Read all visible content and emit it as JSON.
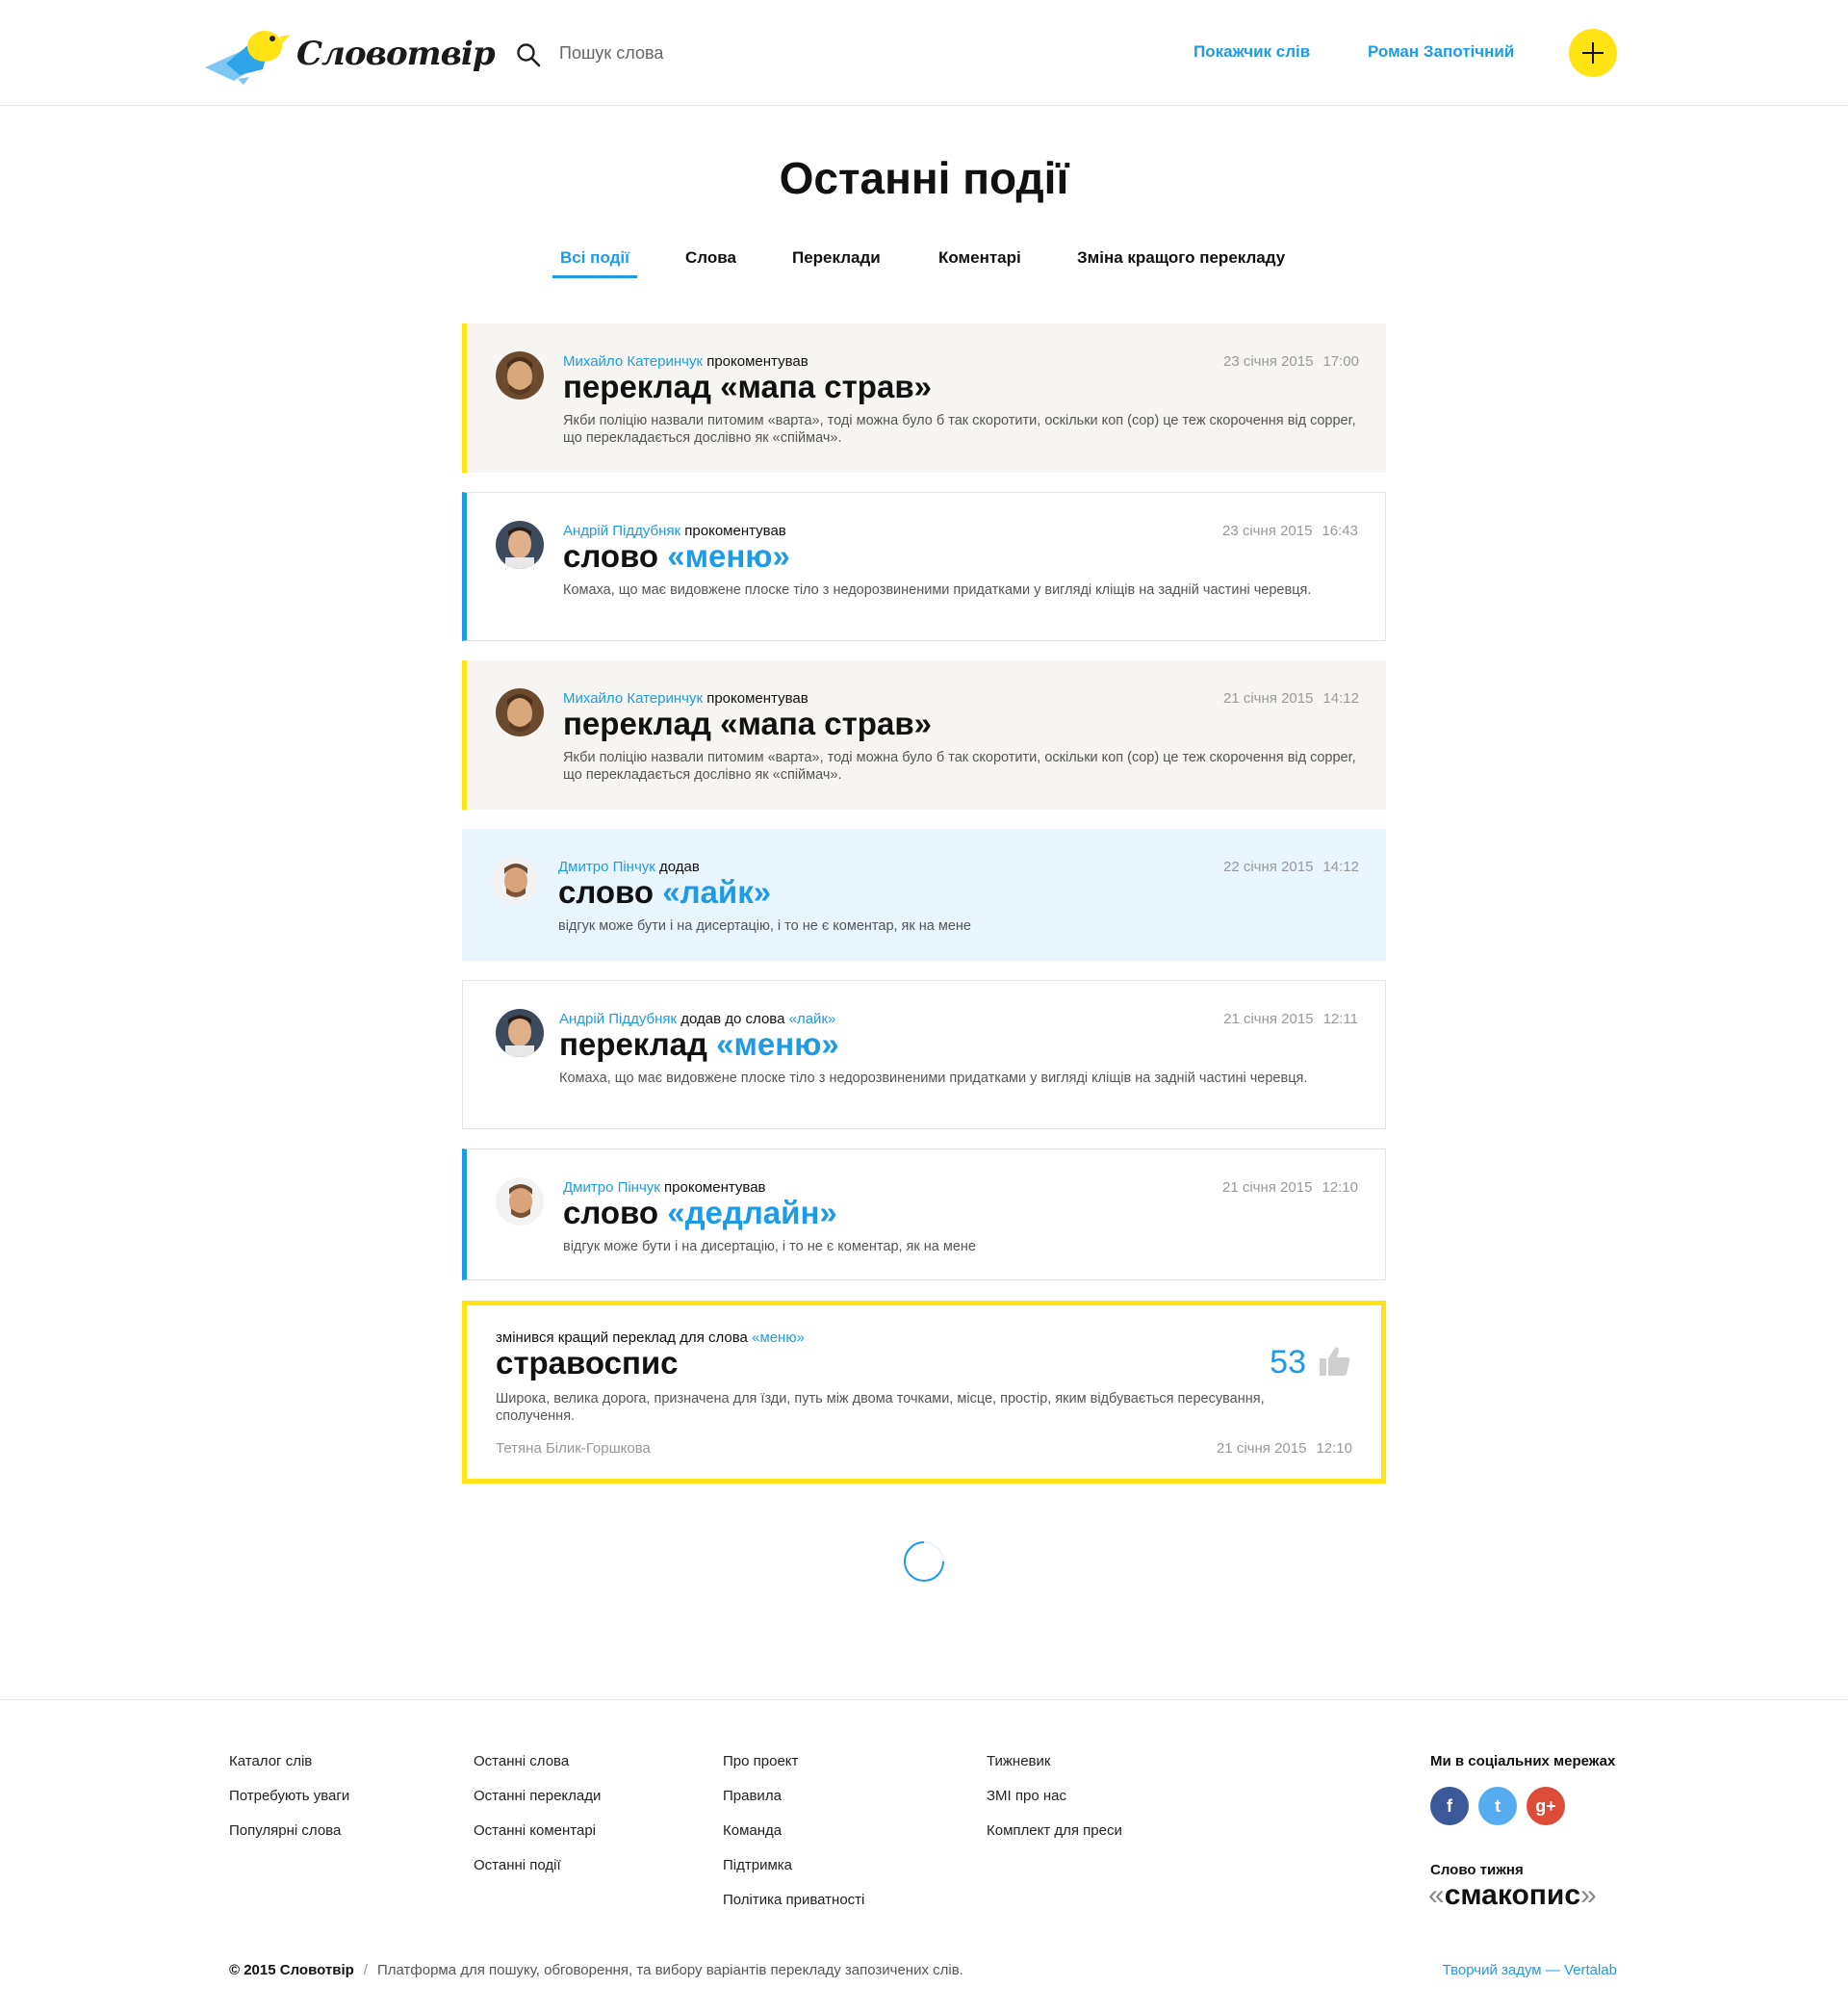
{
  "header": {
    "logo_text": "Словотвір",
    "search_placeholder": "Пошук слова",
    "nav": [
      "Покажчик слів",
      "Роман Запотічний"
    ]
  },
  "page": {
    "title": "Останні події",
    "tabs": [
      "Всі події",
      "Слова",
      "Переклади",
      "Коментарі",
      "Зміна кращого перекладу"
    ],
    "active_tab": "Всі події"
  },
  "events": [
    {
      "style": "beige",
      "user": "Михайло Катеринчук",
      "action": "прокоментував",
      "date": "23 січня 2015",
      "time": "17:00",
      "kind": "переклад",
      "word": "«мапа страв»",
      "text": "Якби поліцію назвали питомим «варта», тоді можна було б так скоротити, оскільки коп (cop) це теж скорочення від copper, що перекладається дослівно як «спіймач»."
    },
    {
      "style": "white-blue",
      "user": "Андрій Піддубняк",
      "action": "прокоментував",
      "date": "23 січня 2015",
      "time": "16:43",
      "kind": "слово",
      "word": "«меню»",
      "text": "Комаха, що має видовжене плоске тіло з недорозвиненими придатками у вигляді кліщів на задній частині черевця."
    },
    {
      "style": "beige",
      "user": "Михайло Катеринчук",
      "action": "прокоментував",
      "date": "21 січня 2015",
      "time": "14:12",
      "kind": "переклад",
      "word": "«мапа страв»",
      "text": "Якби поліцію назвали питомим «варта», тоді можна було б так скоротити, оскільки коп (cop) це теж скорочення від copper, що перекладається дослівно як «спіймач»."
    },
    {
      "style": "blue",
      "user": "Дмитро Пінчук",
      "action": "додав",
      "date": "22 січня 2015",
      "time": "14:12",
      "kind": "слово",
      "word": "«лайк»",
      "text": "відгук може бути і на дисертацію, і то не є коментар, як на мене"
    },
    {
      "style": "white",
      "user": "Андрій Піддубняк",
      "action": "додав до слова",
      "action_word": "«лайк»",
      "date": "21 січня 2015",
      "time": "12:11",
      "kind": "переклад",
      "word": "«меню»",
      "text": "Комаха, що має видовжене плоске тіло з недорозвиненими придатками у вигляді кліщів на задній частині черевця."
    },
    {
      "style": "white-blue",
      "user": "Дмитро Пінчук",
      "action": "прокоментував",
      "date": "21 січня 2015",
      "time": "12:10",
      "kind": "слово",
      "word": "«дедлайн»",
      "text": "відгук може бути і на дисертацію, і то не є коментар, як на мене"
    }
  ],
  "best_change": {
    "label": "змінився кращий переклад для слова",
    "word": "«меню»",
    "translation": "стравоспис",
    "votes": "53",
    "text": "Широка, велика дорога, призначена для їзди, путь між двома точками, місце, простір, яким відбувається пересування, сполучення.",
    "author": "Тетяна Білик-Горшкова",
    "date": "21 січня 2015",
    "time": "12:10"
  },
  "footer": {
    "col1": [
      "Каталог слів",
      "Потребують уваги",
      "Популярні слова"
    ],
    "col2": [
      "Останні слова",
      "Останні переклади",
      "Останні коментарі",
      "Останні події"
    ],
    "col3": [
      "Про проект",
      "Правила",
      "Команда",
      "Підтримка",
      "Політика приватності"
    ],
    "col4": [
      "Тижневик",
      "ЗМІ про нас",
      "Комплект для преси"
    ],
    "social_title": "Ми в соціальних мережах",
    "social": [
      {
        "name": "facebook-icon",
        "glyph": "f",
        "color": "#3b5998"
      },
      {
        "name": "twitter-icon",
        "glyph": "t",
        "color": "#55acee"
      },
      {
        "name": "google-plus-icon",
        "glyph": "g+",
        "color": "#dd4b39"
      }
    ],
    "word_of_week_title": "Слово тижня",
    "word_of_week": "смакопис",
    "copyright": "© 2015 Словотвір",
    "tagline": "Платформа для пошуку, обговорення, та вибору варіантів перекладу запозичених слів.",
    "credits": "Творчий задум — Vertalab"
  },
  "colors": {
    "accent_blue": "#1e9be6",
    "accent_yellow": "#ffe312",
    "beige": "#f6f5f1",
    "light_blue": "#e8f5fd"
  }
}
